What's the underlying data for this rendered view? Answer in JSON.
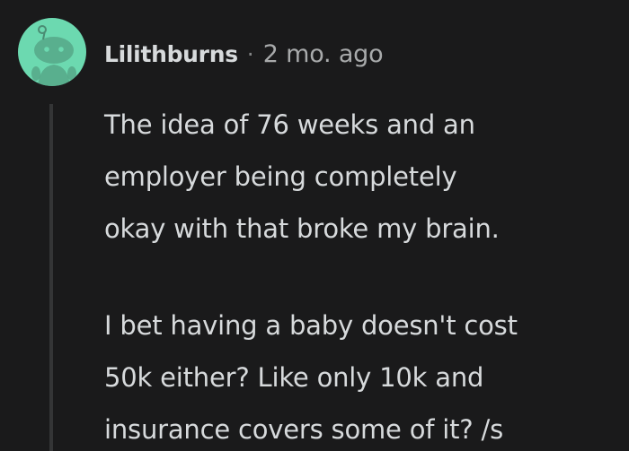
{
  "comment": {
    "author": "Lilithburns",
    "separator": "·",
    "timestamp": "2 mo. ago",
    "avatar_icon": "snoo-avatar-icon",
    "colors": {
      "background": "#1a1a1b",
      "avatar_bg": "#6cd9b0",
      "text": "#d7dadc",
      "muted": "#818384"
    },
    "paragraphs": [
      {
        "lines": [
          "The idea of 76 weeks and an",
          "employer being completely",
          "okay with that broke my brain."
        ]
      },
      {
        "lines": [
          "I bet having a baby doesn't cost",
          "50k either? Like only 10k and",
          "insurance covers some of it? /s"
        ]
      }
    ]
  }
}
